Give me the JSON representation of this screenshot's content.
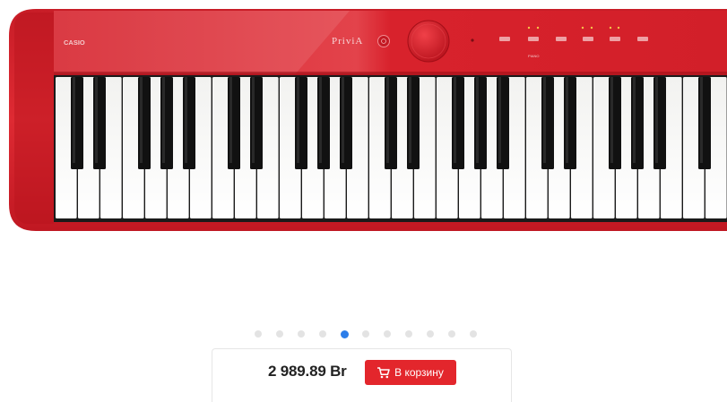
{
  "product": {
    "brand_text": "CASIO",
    "model_text": "PriviA",
    "image_alt": "Casio Privia digital piano, red",
    "panel_small_label": "PIANO"
  },
  "carousel": {
    "total": 11,
    "active": 4
  },
  "purchase": {
    "price": "2 989.89 Br",
    "cart_label": "В корзину"
  },
  "colors": {
    "body_red": "#d8222c",
    "active_dot": "#2b7de9",
    "cart_button": "#e3262c"
  },
  "icons": {
    "cart": "shopping-cart-icon"
  }
}
